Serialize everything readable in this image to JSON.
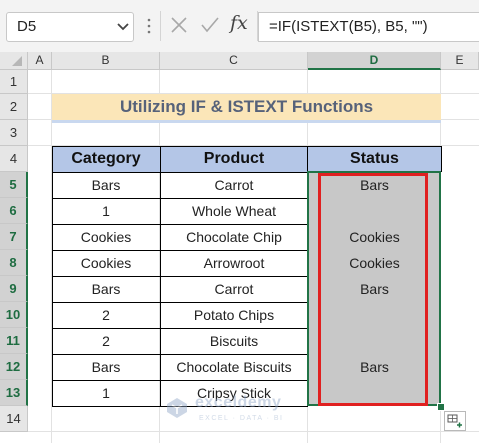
{
  "formula_bar": {
    "name_box": "D5",
    "formula": "=IF(ISTEXT(B5), B5, \"\")",
    "fx_label": "fx"
  },
  "columns": [
    "A",
    "B",
    "C",
    "D",
    "E"
  ],
  "selected_column": "D",
  "rows": [
    "1",
    "2",
    "3",
    "4",
    "5",
    "6",
    "7",
    "8",
    "9",
    "10",
    "11",
    "12",
    "13",
    "14"
  ],
  "selected_rows": [
    "5",
    "6",
    "7",
    "8",
    "9",
    "10",
    "11",
    "12",
    "13"
  ],
  "title": "Utilizing IF & ISTEXT Functions",
  "table": {
    "headers": [
      "Category",
      "Product",
      "Status"
    ],
    "rows": [
      [
        "Bars",
        "Carrot",
        "Bars"
      ],
      [
        "1",
        "Whole Wheat",
        ""
      ],
      [
        "Cookies",
        "Chocolate Chip",
        "Cookies"
      ],
      [
        "Cookies",
        "Arrowroot",
        "Cookies"
      ],
      [
        "Bars",
        "Carrot",
        "Bars"
      ],
      [
        "2",
        "Potato Chips",
        ""
      ],
      [
        "2",
        "Biscuits",
        ""
      ],
      [
        "Bars",
        "Chocolate Biscuits",
        "Bars"
      ],
      [
        "1",
        "Cripsy Stick",
        ""
      ]
    ]
  },
  "watermark": {
    "name": "exceldemy",
    "tagline": "EXCEL · DATA · BI"
  },
  "colors": {
    "title_fill": "#fbe6b8",
    "header_fill": "#b4c6e7",
    "status_fill": "#c8c8c8",
    "selection": "#217346",
    "highlight": "#e02020"
  }
}
